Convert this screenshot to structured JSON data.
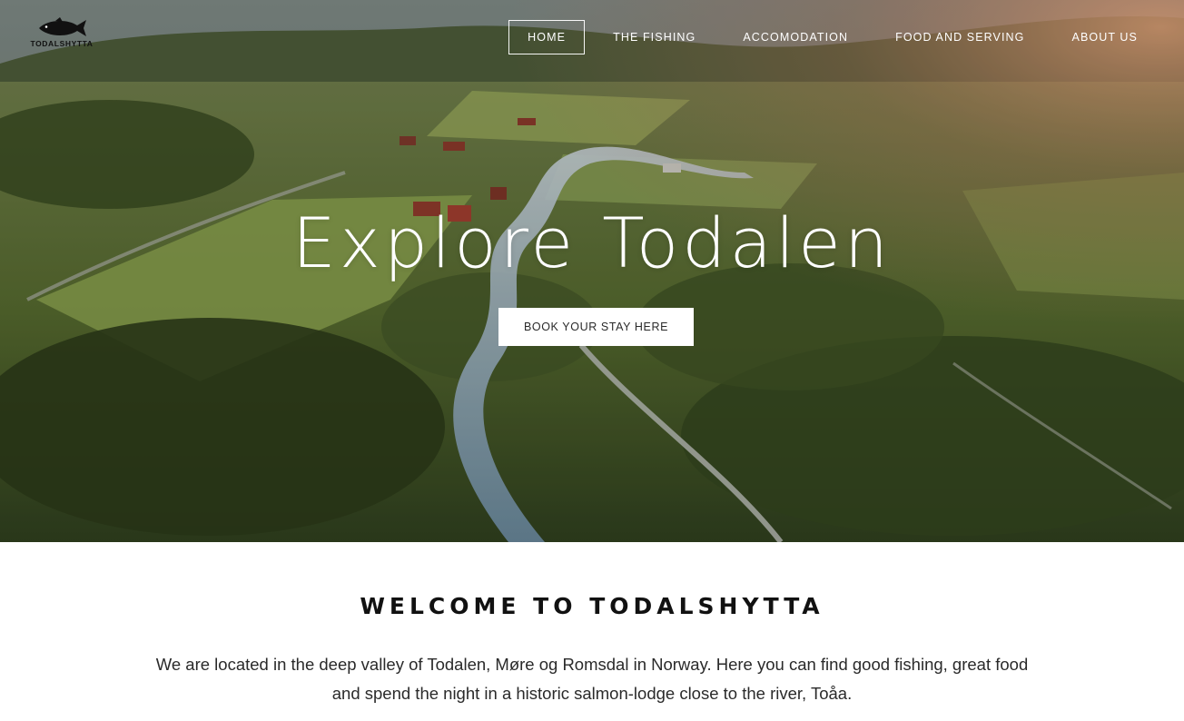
{
  "brand": {
    "name": "TODALSHYTTA",
    "logo_icon": "salmon-icon"
  },
  "nav": {
    "items": [
      {
        "label": "HOME",
        "active": true
      },
      {
        "label": "THE FISHING",
        "active": false
      },
      {
        "label": "ACCOMODATION",
        "active": false
      },
      {
        "label": "FOOD AND SERVING",
        "active": false
      },
      {
        "label": "ABOUT US",
        "active": false
      }
    ]
  },
  "hero": {
    "title": "Explore Todalen",
    "button_label": "BOOK YOUR STAY HERE",
    "image": "aerial view of river valley with forest, fields and farmhouses"
  },
  "welcome": {
    "title": "WELCOME TO TODALSHYTTA",
    "text_line1": "We are located in the deep valley of Todalen, Møre og Romsdal in Norway. Here you can find good fishing, great food",
    "text_line2": "and spend the night in a historic salmon-lodge close to the river, Toåa."
  },
  "colors": {
    "nav_text": "#ffffff",
    "heading": "#111111",
    "body_text": "#2a2a2a",
    "button_bg": "#ffffff"
  }
}
